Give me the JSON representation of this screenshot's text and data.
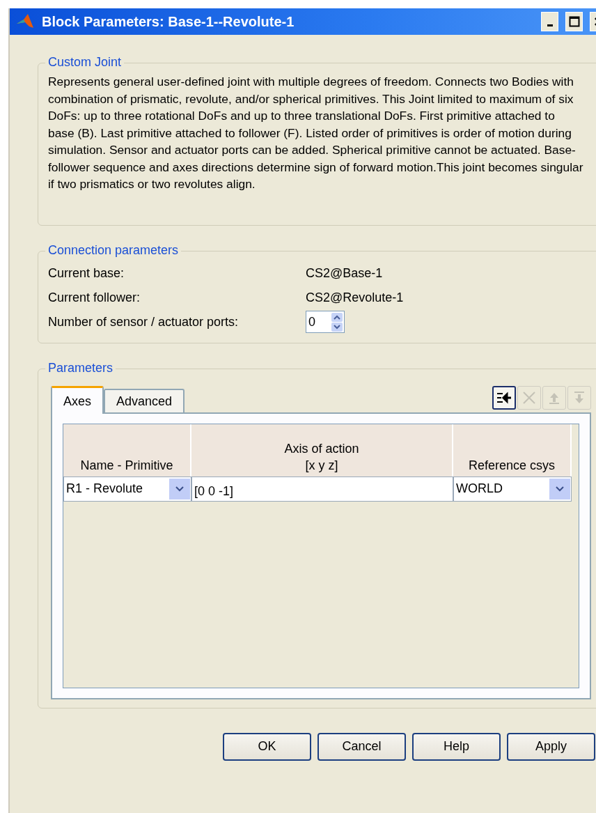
{
  "window": {
    "title": "Block Parameters: Base-1--Revolute-1"
  },
  "description_group": {
    "title": "Custom Joint",
    "text": "Represents general user-defined joint with multiple degrees of freedom. Connects two Bodies with combination of prismatic, revolute, and/or spherical primitives. This Joint limited to maximum of six DoFs: up to three rotational DoFs and up to three translational DoFs. First primitive attached to base (B). Last primitive attached to follower (F). Listed order of primitives is order of motion during simulation. Sensor and actuator ports can be added. Spherical primitive cannot be actuated. Base-follower sequence and axes directions determine sign of forward motion.This joint becomes singular if two prismatics or two revolutes align."
  },
  "connection_group": {
    "title": "Connection parameters",
    "rows": [
      {
        "kind": "text",
        "label": "Current base:",
        "value": "CS2@Base-1"
      },
      {
        "kind": "text",
        "label": "Current follower:",
        "value": "CS2@Revolute-1"
      },
      {
        "kind": "spinner",
        "label": "Number of sensor / actuator ports:",
        "value": "0"
      }
    ]
  },
  "parameters_group": {
    "title": "Parameters",
    "tabs": [
      {
        "label": "Axes",
        "selected": true
      },
      {
        "label": "Advanced",
        "selected": false
      }
    ],
    "toolbar": [
      {
        "kind": "insert",
        "disabled": false
      },
      {
        "kind": "delete",
        "disabled": true
      },
      {
        "kind": "up",
        "disabled": true
      },
      {
        "kind": "down",
        "disabled": true
      }
    ],
    "table": {
      "columns": [
        {
          "lines": [
            "Name - Primitive"
          ]
        },
        {
          "lines": [
            "Axis of action",
            "[x y z]"
          ]
        },
        {
          "lines": [
            "Reference csys"
          ]
        }
      ],
      "rows": [
        {
          "primitive": "R1 - Revolute",
          "axis": "[0 0 -1]",
          "reference_csys": "WORLD"
        }
      ]
    }
  },
  "buttons": [
    "OK",
    "Cancel",
    "Help",
    "Apply"
  ]
}
